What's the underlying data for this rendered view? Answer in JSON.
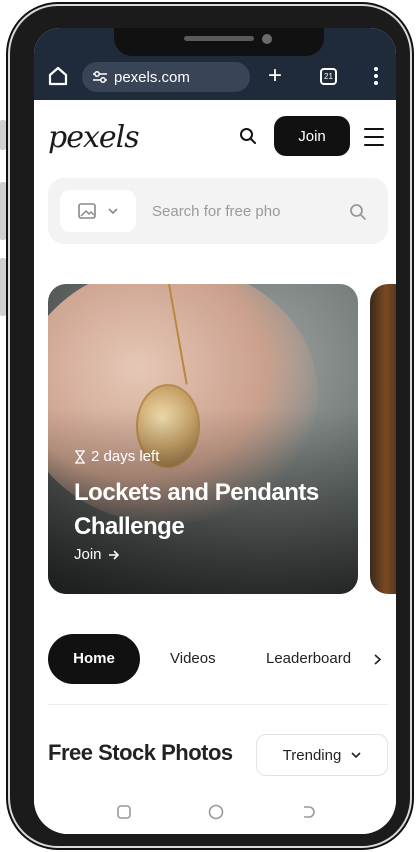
{
  "browser": {
    "url": "pexels.com",
    "tab_count": "21"
  },
  "site": {
    "logo": "pexels",
    "join_label": "Join"
  },
  "search": {
    "placeholder": "Search for free pho"
  },
  "challenge": {
    "days_left": "2 days left",
    "title": "Lockets and Pendants Challenge",
    "join_label": "Join"
  },
  "tabs": [
    {
      "label": "Home",
      "active": true
    },
    {
      "label": "Videos",
      "active": false
    },
    {
      "label": "Leaderboard",
      "active": false
    }
  ],
  "section": {
    "title": "Free Stock Photos",
    "sort_label": "Trending"
  },
  "colors": {
    "browser_bar": "#1f2a3a",
    "accent_black": "#111111"
  }
}
